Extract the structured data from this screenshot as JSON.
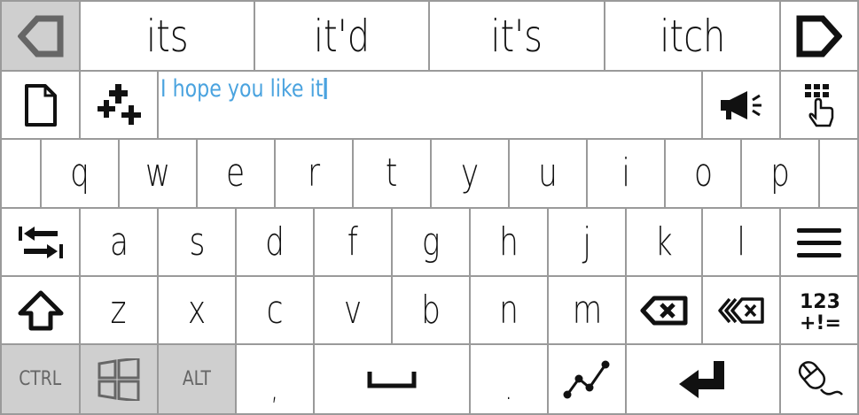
{
  "suggestions": [
    "its",
    "it'd",
    "it's",
    "itch"
  ],
  "text_area": {
    "value": "I hope you like it"
  },
  "rows": {
    "row1": [
      "q",
      "w",
      "e",
      "r",
      "t",
      "y",
      "u",
      "i",
      "o",
      "p"
    ],
    "row2": [
      "a",
      "s",
      "d",
      "f",
      "g",
      "h",
      "j",
      "k",
      "l"
    ],
    "row3": [
      "z",
      "x",
      "c",
      "v",
      "b",
      "n",
      "m"
    ]
  },
  "bottom": {
    "ctrl": "CTRL",
    "alt": "ALT",
    "comma": ",",
    "period": "."
  },
  "icons": {
    "back": "back-arrow-icon",
    "forward": "forward-arrow-icon",
    "document": "document-icon",
    "sparkle": "add-sparkle-icon",
    "megaphone": "megaphone-icon",
    "keypad_touch": "keypad-touch-icon",
    "tab": "tab-icon",
    "menu": "menu-icon",
    "shift": "shift-icon",
    "backspace": "backspace-icon",
    "delete_word": "delete-word-icon",
    "numbers": "numbers-symbols-icon",
    "windows": "windows-logo-icon",
    "space": "space-icon",
    "swipe": "swipe-path-icon",
    "enter": "enter-icon",
    "mouse": "mouse-icon"
  },
  "colors": {
    "typed_text": "#4aa3df",
    "modifier_bg": "#cfcfcf",
    "border": "#9a9a9a"
  }
}
